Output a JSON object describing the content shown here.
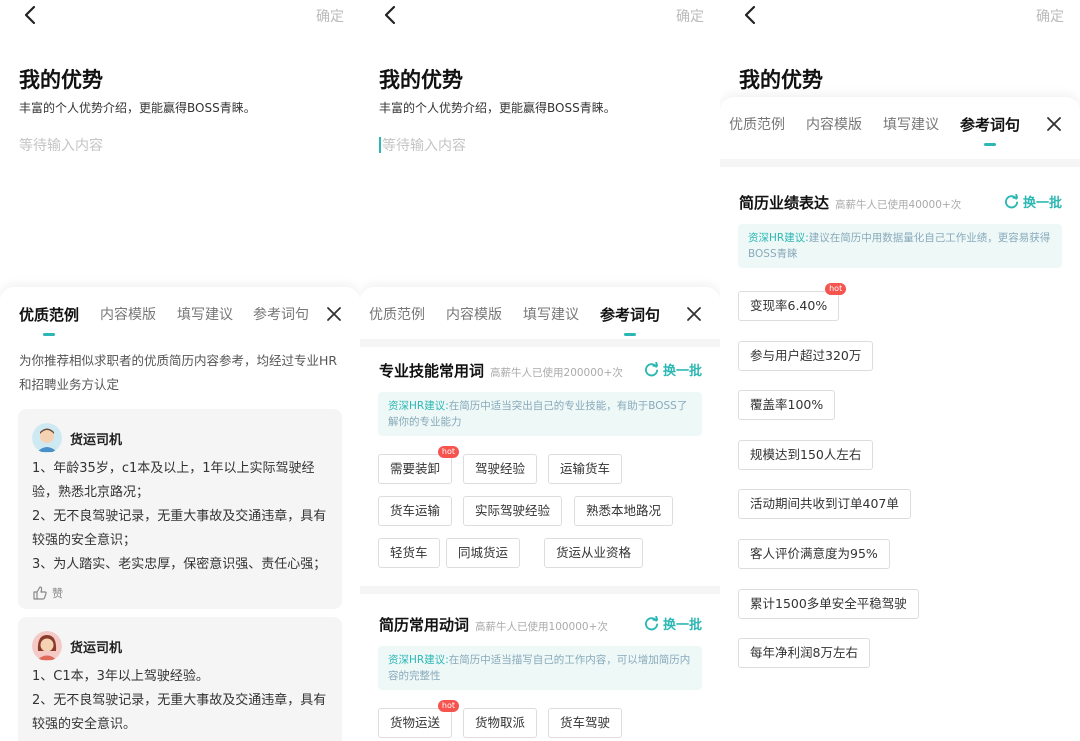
{
  "common": {
    "confirm": "确定",
    "title": "我的优势",
    "subtitle": "丰富的个人优势介绍，更能赢得BOSS青睐。",
    "placeholder": "等待输入内容"
  },
  "tabs": [
    "优质范例",
    "内容模版",
    "填写建议",
    "参考词句"
  ],
  "screen1": {
    "tab_last_truncated": "参考词句",
    "intro": "为你推荐相似求职者的优质简历内容参考，均经过专业HR和招聘业务方认定",
    "cards": [
      {
        "name": "货运司机",
        "lines": [
          "1、年龄35岁，c1本及以上，1年以上实际驾驶经验，熟悉北京路况；",
          "2、无不良驾驶记录，无重大事故及交通违章，具有较强的安全意识；",
          "3、为人踏实、老实忠厚，保密意识强、责任心强；"
        ],
        "like": "赞"
      },
      {
        "name": "货运司机",
        "lines": [
          "1、C1本，3年以上驾驶经验。",
          "2、无不良驾驶记录，无重大事故及交通违章，具有较强的安全意识。"
        ]
      }
    ]
  },
  "screen2": {
    "sections": [
      {
        "title": "专业技能常用词",
        "meta": "高薪牛人已使用200000+次",
        "refresh": "换一批",
        "tip_label": "资深HR建议:",
        "tip": "在简历中适当突出自己的专业技能，有助于BOSS了解你的专业能力",
        "chips": [
          "需要装卸",
          "驾驶经验",
          "运输货车",
          "货车运输",
          "实际驾驶经验",
          "熟悉本地路况",
          "轻货车",
          "同城货运",
          "货运从业资格"
        ]
      },
      {
        "title": "简历常用动词",
        "meta": "高薪牛人已使用100000+次",
        "refresh": "换一批",
        "tip_label": "资深HR建议:",
        "tip": "在简历中适当描写自己的工作内容，可以增加简历内容的完整性",
        "chips": [
          "货物运送",
          "货物取派",
          "货车驾驶"
        ]
      }
    ],
    "hot_label": "hot"
  },
  "screen3": {
    "section": {
      "title": "简历业绩表达",
      "meta": "高薪牛人已使用40000+次",
      "refresh": "换一批",
      "tip_label": "资深HR建议:",
      "tip": "建议在简历中用数据量化自己工作业绩，更容易获得BOSS青睐",
      "chips": [
        "变现率6.40%",
        "参与用户超过320万",
        "覆盖率100%",
        "规模达到150人左右",
        "活动期间共收到订单407单",
        "客人评价满意度为95%",
        "累计1500多单安全平稳驾驶",
        "每年净利润8万左右"
      ]
    },
    "hot_label": "hot"
  },
  "colors": {
    "accent": "#2bb7b3",
    "hot": "#f5544f"
  }
}
